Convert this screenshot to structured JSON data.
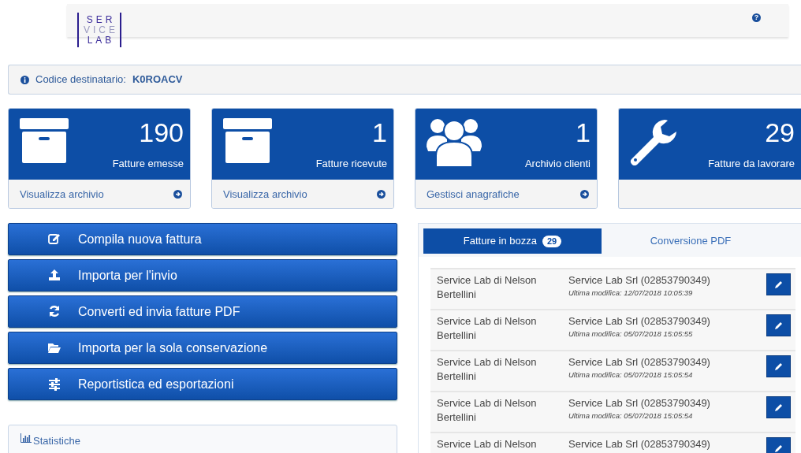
{
  "header": {
    "logo_lines": [
      "SER",
      "VICE",
      "LAB"
    ],
    "help_icon": "?"
  },
  "info_bar": {
    "label": "Codice destinatario:",
    "value": "K0ROACV"
  },
  "stat_cards": [
    {
      "kind": "archive",
      "count": "190",
      "label": "Fatture emesse",
      "link": "Visualizza archivio"
    },
    {
      "kind": "archive",
      "count": "1",
      "label": "Fatture ricevute",
      "link": "Visualizza archivio"
    },
    {
      "kind": "users",
      "count": "1",
      "label": "Archivio clienti",
      "link": "Gestisci anagrafiche"
    },
    {
      "kind": "wrench",
      "count": "29",
      "label": "Fatture da lavorare"
    }
  ],
  "actions": [
    {
      "kind": "edit",
      "label": "Compila nuova fattura"
    },
    {
      "kind": "upload",
      "label": "Importa per l'invio"
    },
    {
      "kind": "refresh",
      "label": "Converti ed invia fatture PDF"
    },
    {
      "kind": "folder",
      "label": "Importa per la sola conservazione"
    },
    {
      "kind": "sliders",
      "label": "Reportistica ed esportazioni"
    }
  ],
  "stats_panel": {
    "title": "Statistiche"
  },
  "tabs": [
    {
      "label": "Fatture in bozza",
      "badge": "29",
      "selected": true
    },
    {
      "label": "Conversione PDF",
      "selected": false
    }
  ],
  "drafts": [
    {
      "sender": "Service Lab di Nelson Bertellini",
      "client": "Service Lab Srl (02853790349)",
      "modified": "Ultima modifica: 12/07/2018 10:05:39"
    },
    {
      "sender": "Service Lab di Nelson Bertellini",
      "client": "Service Lab Srl (02853790349)",
      "modified": "Ultima modifica: 05/07/2018 15:05:55"
    },
    {
      "sender": "Service Lab di Nelson Bertellini",
      "client": "Service Lab Srl (02853790349)",
      "modified": "Ultima modifica: 05/07/2018 15:05:54"
    },
    {
      "sender": "Service Lab di Nelson Bertellini",
      "client": "Service Lab Srl (02853790349)",
      "modified": "Ultima modifica: 05/07/2018 15:05:54"
    },
    {
      "sender": "Service Lab di Nelson",
      "client": "Service Lab Srl (02853790349)"
    }
  ]
}
